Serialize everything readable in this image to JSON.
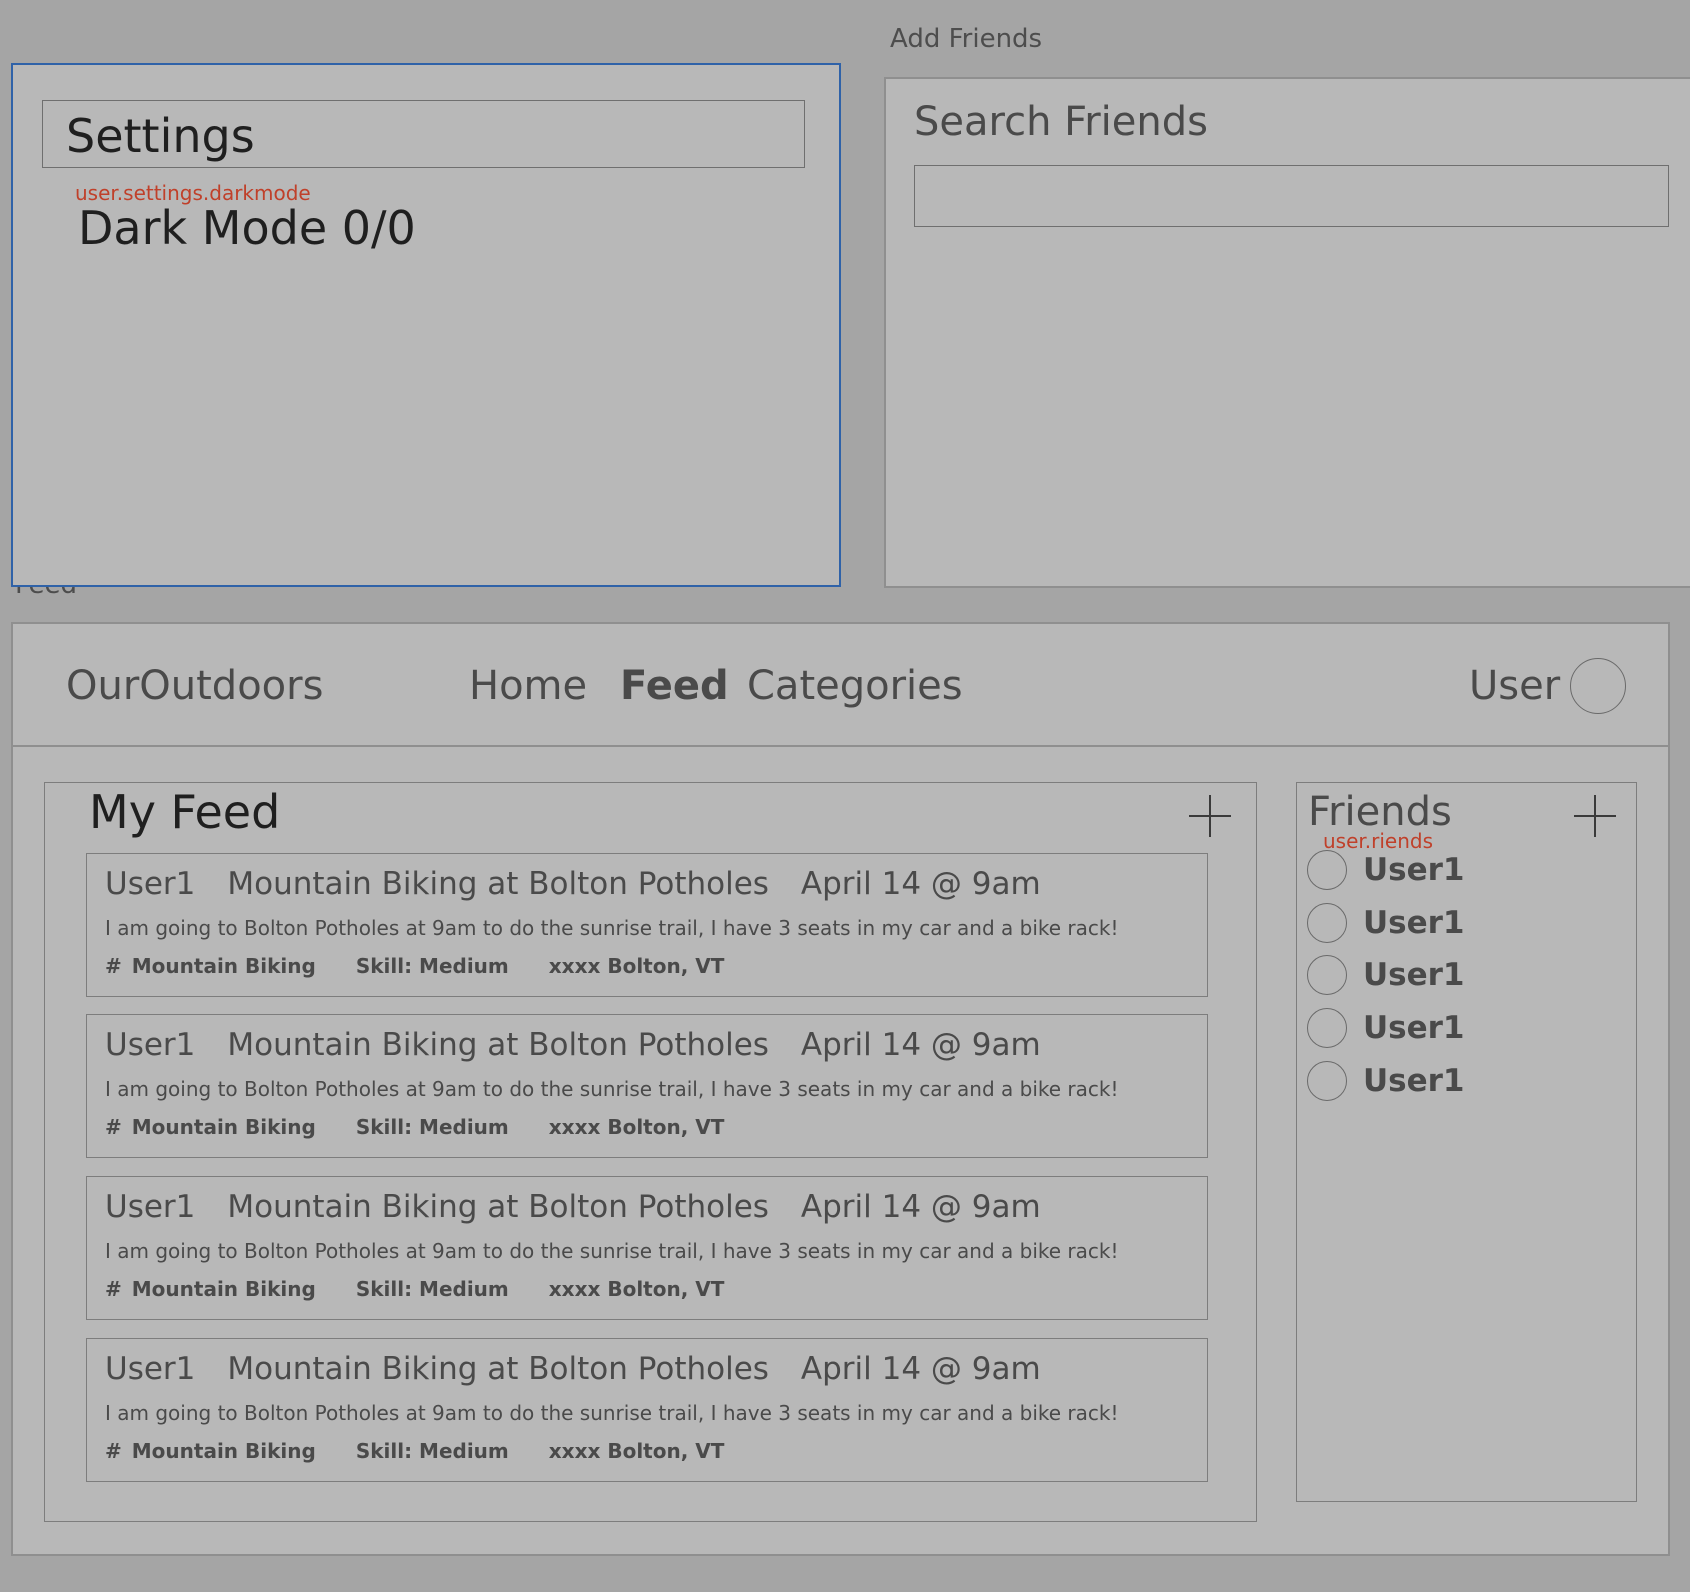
{
  "frames": {
    "add_friends_label": "Add Friends",
    "feed_label": "Feed"
  },
  "settings": {
    "title": "Settings",
    "annotation": "user.settings.darkmode",
    "dark_mode_label": "Dark Mode 0/0"
  },
  "add_friends": {
    "title": "Search Friends",
    "search_value": ""
  },
  "navbar": {
    "brand": "OurOutdoors",
    "links": [
      "Home",
      "Feed",
      "Categories"
    ],
    "active_link": "Feed",
    "user_label": "User"
  },
  "feed": {
    "title": "My Feed",
    "posts": [
      {
        "user": "User1",
        "title": "Mountain Biking at Bolton Potholes",
        "date": "April 14 @ 9am",
        "body": "I am going to Bolton Potholes at 9am to do the sunrise trail, I have 3 seats in my car and a bike rack!",
        "hash": "#",
        "category": "Mountain Biking",
        "skill": "Skill: Medium",
        "location": "xxxx Bolton, VT"
      },
      {
        "user": "User1",
        "title": "Mountain Biking at Bolton Potholes",
        "date": "April 14 @ 9am",
        "body": "I am going to Bolton Potholes at 9am to do the sunrise trail, I have 3 seats in my car and a bike rack!",
        "hash": "#",
        "category": "Mountain Biking",
        "skill": "Skill: Medium",
        "location": "xxxx Bolton, VT"
      },
      {
        "user": "User1",
        "title": "Mountain Biking at Bolton Potholes",
        "date": "April 14 @ 9am",
        "body": "I am going to Bolton Potholes at 9am to do the sunrise trail, I have 3 seats in my car and a bike rack!",
        "hash": "#",
        "category": "Mountain Biking",
        "skill": "Skill: Medium",
        "location": "xxxx Bolton, VT"
      },
      {
        "user": "User1",
        "title": "Mountain Biking at Bolton Potholes",
        "date": "April 14 @ 9am",
        "body": "I am going to Bolton Potholes at 9am to do the sunrise trail, I have 3 seats in my car and a bike rack!",
        "hash": "#",
        "category": "Mountain Biking",
        "skill": "Skill: Medium",
        "location": "xxxx Bolton, VT"
      }
    ]
  },
  "friends": {
    "title": "Friends",
    "annotation": "user.riends",
    "items": [
      "User1",
      "User1",
      "User1",
      "User1",
      "User1"
    ]
  },
  "colors": {
    "background": "#a5a5a5",
    "panel": "#b8b8b8",
    "selection": "#2f62a8",
    "annotation": "#c0402a"
  },
  "icons": {
    "add_post": "plus-icon",
    "add_friend": "plus-icon",
    "avatar": "circle-avatar"
  }
}
